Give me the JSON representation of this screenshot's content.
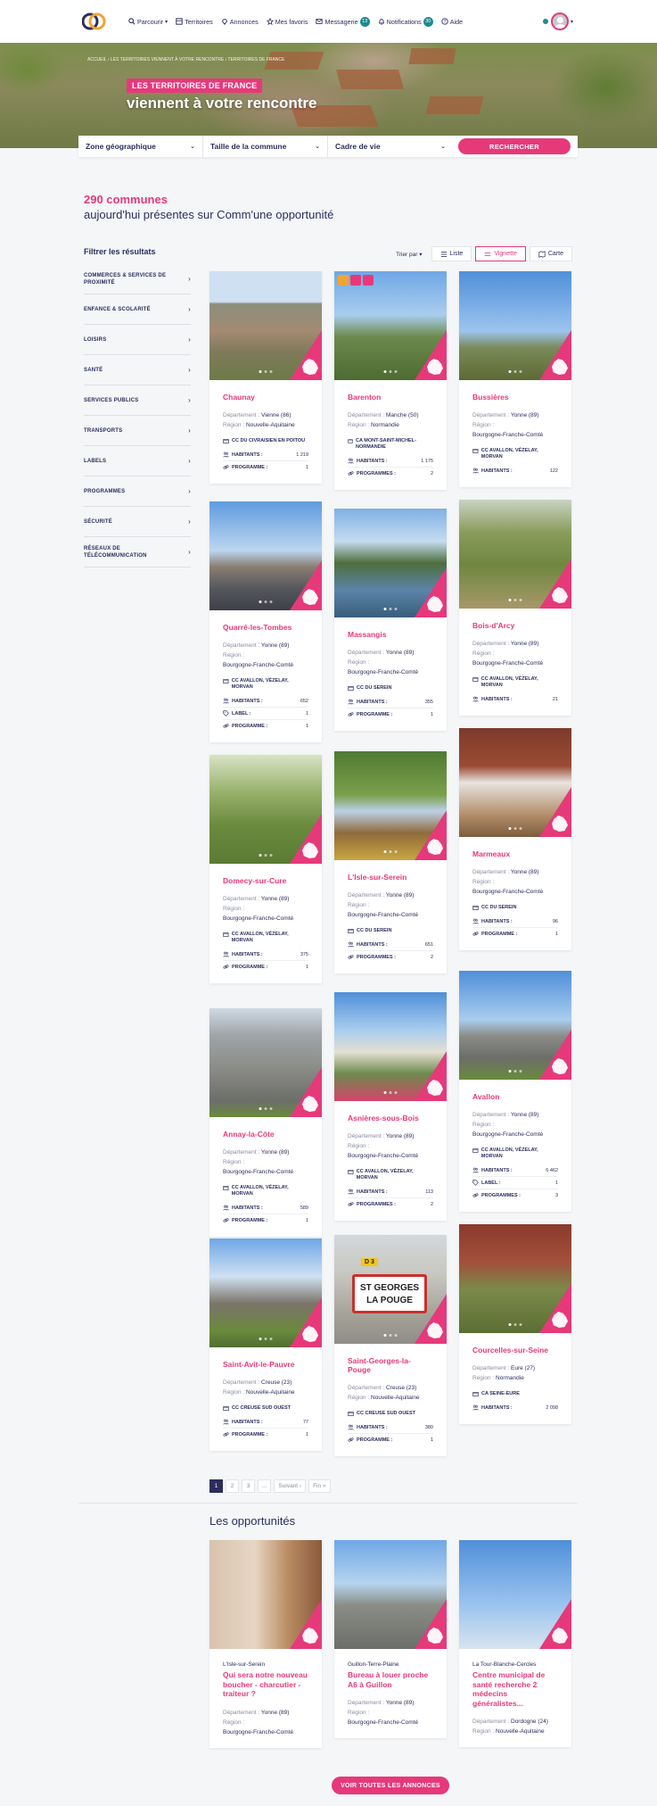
{
  "nav": {
    "items": [
      {
        "label": "Parcourir",
        "icon": "search-icon",
        "caret": "▾"
      },
      {
        "label": "Territoires",
        "icon": "building-icon"
      },
      {
        "label": "Annonces",
        "icon": "map-pin-icon"
      },
      {
        "label": "Mes favoris",
        "icon": "star-icon"
      },
      {
        "label": "Messagerie",
        "icon": "mail-icon",
        "badge": "13"
      },
      {
        "label": "Notifications",
        "icon": "bell-icon",
        "badge": "30"
      },
      {
        "label": "Aide",
        "icon": "help-icon"
      }
    ]
  },
  "hero": {
    "breadcrumb": "ACCUEIL  ›  LES TERRITOIRES VIENNENT À VOTRE RENCONTRE  ›  TERRITOIRES DE FRANCE",
    "tag": "LES TERRITOIRES DE FRANCE",
    "title": "viennent à votre rencontre"
  },
  "search": {
    "zone": "Zone géographique",
    "taille": "Taille de la commune",
    "cadre": "Cadre de vie",
    "button": "RECHERCHER"
  },
  "results": {
    "count": "290 communes",
    "text": "aujourd'hui présentes sur Comm'une opportunité"
  },
  "filters": {
    "title": "Filtrer les résultats",
    "items": [
      "COMMERCES & SERVICES DE PROXIMITÉ",
      "ENFANCE & SCOLARITÉ",
      "LOISIRS",
      "SANTÉ",
      "SERVICES PUBLICS",
      "TRANSPORTS",
      "LABELS",
      "PROGRAMMES",
      "SÉCURITÉ",
      "RÉSEAUX DE TÉLÉCOMMUNICATION"
    ]
  },
  "controls": {
    "sort": "Trier par",
    "liste": "Liste",
    "vignette": "Vignette",
    "carte": "Carte"
  },
  "labels": {
    "departement": "Département :",
    "region": "Région :",
    "habitants": "HABITANTS :",
    "programme": "PROGRAMME :",
    "programmes": "PROGRAMMES :",
    "label": "LABEL :",
    "labels": "LABELS :"
  },
  "communes": [
    {
      "name": "Chaunay",
      "dep": "Vienne (86)",
      "region": "Nouvelle-Aquitaine",
      "cc": "CC DU CIVRAISIEN EN POITOU",
      "habitants": "1 219",
      "programme": "1"
    },
    {
      "name": "Barenton",
      "dep": "Manche (50)",
      "region": "Normandie",
      "cc": "CA MONT-SAINT-MICHEL-NORMANDIE",
      "habitants": "1 175",
      "programmes": "2"
    },
    {
      "name": "Bussières",
      "dep": "Yonne (89)",
      "region": "Bourgogne-Franche-Comté",
      "cc": "CC AVALLON, VÉZELAY, MORVAN",
      "habitants": "122"
    },
    {
      "name": "Quarré-les-Tombes",
      "dep": "Yonne (89)",
      "region": "Bourgogne-Franche-Comté",
      "cc": "CC AVALLON, VÉZELAY, MORVAN",
      "habitants": "652",
      "label": "1",
      "programme": "1"
    },
    {
      "name": "Massangis",
      "dep": "Yonne (89)",
      "region": "Bourgogne-Franche-Comté",
      "cc": "CC DU SEREIN",
      "habitants": "355",
      "programme": "1"
    },
    {
      "name": "Bois-d'Arcy",
      "dep": "Yonne (89)",
      "region": "Bourgogne-Franche-Comté",
      "cc": "CC AVALLON, VÉZELAY, MORVAN",
      "habitants": "21"
    },
    {
      "name": "Domecy-sur-Cure",
      "dep": "Yonne (89)",
      "region": "Bourgogne-Franche-Comté",
      "cc": "CC AVALLON, VÉZELAY, MORVAN",
      "habitants": "375",
      "programme": "1"
    },
    {
      "name": "L'Isle-sur-Serein",
      "dep": "Yonne (89)",
      "region": "Bourgogne-Franche-Comté",
      "cc": "CC DU SEREIN",
      "habitants": "651",
      "programmes": "2"
    },
    {
      "name": "Marmeaux",
      "dep": "Yonne (89)",
      "region": "Bourgogne-Franche-Comté",
      "cc": "CC DU SEREIN",
      "habitants": "96",
      "programme": "1"
    },
    {
      "name": "Annay-la-Côte",
      "dep": "Yonne (89)",
      "region": "Bourgogne-Franche-Comté",
      "cc": "CC AVALLON, VÉZELAY, MORVAN",
      "habitants": "589",
      "programme": "1"
    },
    {
      "name": "Asnières-sous-Bois",
      "dep": "Yonne (89)",
      "region": "Bourgogne-Franche-Comté",
      "cc": "CC AVALLON, VÉZELAY, MORVAN",
      "habitants": "113",
      "programmes": "2"
    },
    {
      "name": "Avallon",
      "dep": "Yonne (89)",
      "region": "Bourgogne-Franche-Comté",
      "cc": "CC AVALLON, VÉZELAY, MORVAN",
      "habitants": "6 462",
      "label": "1",
      "programmes": "3"
    },
    {
      "name": "Saint-Avit-le-Pauvre",
      "dep": "Creuse (23)",
      "region": "Nouvelle-Aquitaine",
      "cc": "CC CREUSE SUD OUEST",
      "habitants": "77",
      "programme": "1"
    },
    {
      "name": "Saint-Georges-la-Pouge",
      "dep": "Creuse (23)",
      "region": "Nouvelle-Aquitaine",
      "cc": "CC CREUSE SUD OUEST",
      "habitants": "380",
      "programme": "1"
    },
    {
      "name": "Courcelles-sur-Seine",
      "dep": "Eure (27)",
      "region": "Normandie",
      "cc": "CA SEINE-EURE",
      "habitants": "2 098"
    }
  ],
  "sign": {
    "line1": "ST GEORGES",
    "line2": "LA POUGE",
    "top": "D 3"
  },
  "pagination": [
    "1",
    "2",
    "3",
    "...",
    "Suivant ›",
    "Fin »"
  ],
  "opportunities": {
    "title": "Les opportunités",
    "items": [
      {
        "commune": "L'Isle-sur-Serein",
        "title": "Qui sera notre nouveau boucher - charcutier - traiteur ?",
        "dep": "Yonne (89)",
        "region": "Bourgogne-Franche-Comté"
      },
      {
        "commune": "Guillon-Terre-Plaine",
        "title": "Bureau à louer proche A6 à Guillon",
        "dep": "Yonne (89)",
        "region": "Bourgogne-Franche-Comté"
      },
      {
        "commune": "La Tour-Blanche-Cercles",
        "title": "Centre municipal de santé recherche 2 médecins généralistes...",
        "dep": "Dordogne (24)",
        "region": "Nouvelle-Aquitaine"
      }
    ],
    "button": "VOIR TOUTES LES ANNONCES"
  }
}
